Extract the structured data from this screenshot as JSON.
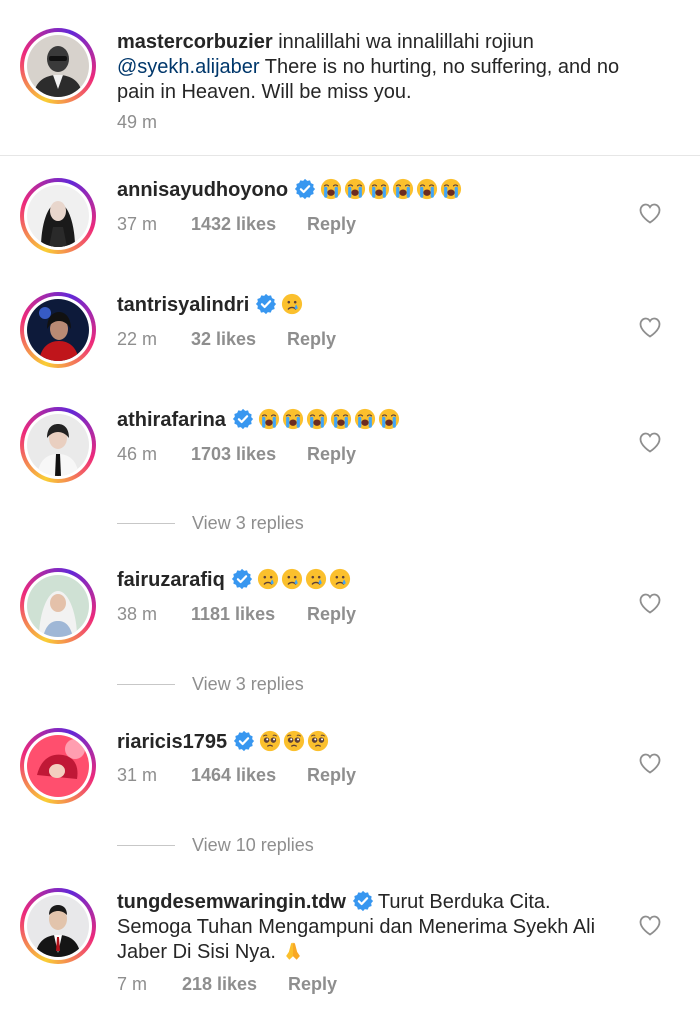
{
  "caption": {
    "username": "mastercorbuzier",
    "text_1": "innalillahi wa innalillahi rojiun",
    "mention": "@syekh.alijaber",
    "text_2": " There is no hurting, no suffering, and no pain in Heaven. Will be miss you.",
    "time": "49 m"
  },
  "comments": [
    {
      "username": "annisayudhoyono",
      "verified": true,
      "emoji_name": "loudly-crying-face",
      "emoji_count": 6,
      "time": "37 m",
      "likes": "1432 likes",
      "reply": "Reply"
    },
    {
      "username": "tantrisyalindri",
      "verified": true,
      "emoji_name": "crying-face",
      "emoji_count": 1,
      "time": "22 m",
      "likes": "32 likes",
      "reply": "Reply"
    },
    {
      "username": "athirafarina",
      "verified": true,
      "emoji_name": "loudly-crying-face",
      "emoji_count": 6,
      "time": "46 m",
      "likes": "1703 likes",
      "reply": "Reply",
      "view_replies": "View 3 replies"
    },
    {
      "username": "fairuzarafiq",
      "verified": true,
      "emoji_name": "crying-face",
      "emoji_count": 4,
      "time": "38 m",
      "likes": "1181 likes",
      "reply": "Reply",
      "view_replies": "View 3 replies"
    },
    {
      "username": "riaricis1795",
      "verified": true,
      "emoji_name": "pleading-face",
      "emoji_count": 3,
      "time": "31 m",
      "likes": "1464 likes",
      "reply": "Reply",
      "view_replies": "View 10 replies"
    },
    {
      "username": "tungdesemwaringin.tdw",
      "verified": true,
      "text": "Turut Berduka Cita. Semoga Tuhan Mengampuni dan Menerima Syekh Ali Jaber Di Sisi Nya.",
      "emoji_name": "folded-hands",
      "time": "7 m",
      "likes": "218 likes",
      "reply": "Reply"
    }
  ],
  "colors": {
    "verified": "#3897f0",
    "username": "#262626",
    "meta": "#8e8e8e",
    "mention": "#00376b"
  }
}
